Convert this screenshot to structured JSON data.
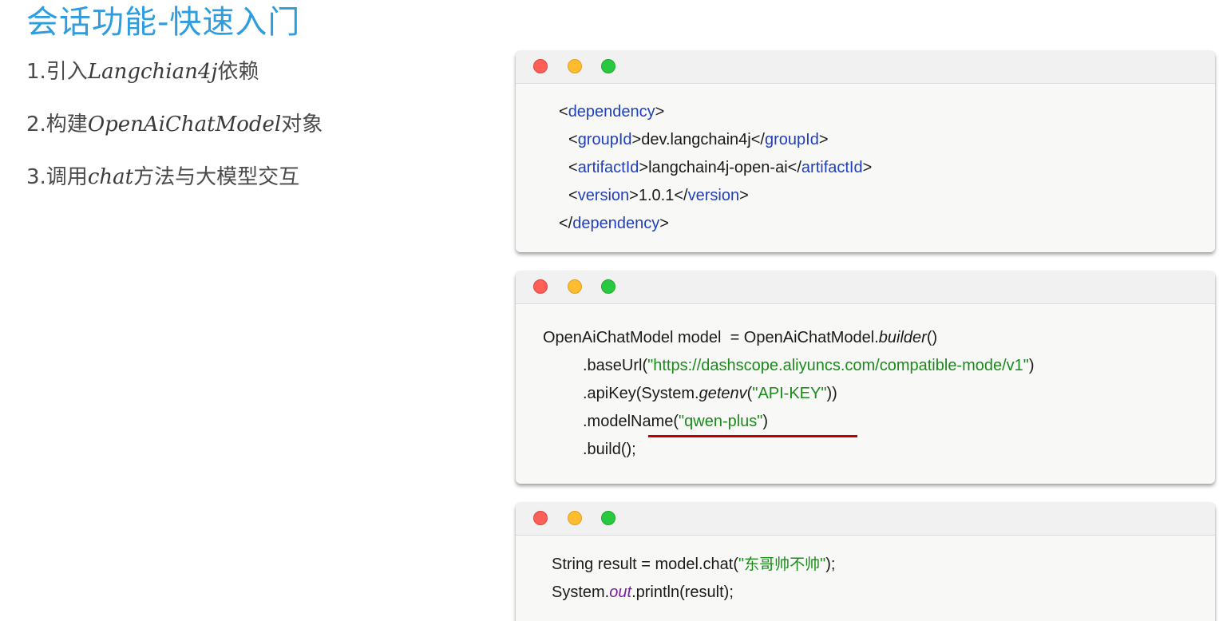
{
  "slide": {
    "title": "会话功能-快速入门",
    "steps": [
      {
        "prefix": "1.引入",
        "keyword": "Langchian4j",
        "suffix": "依赖"
      },
      {
        "prefix": "2.构建",
        "keyword": "OpenAiChatModel",
        "suffix": "对象"
      },
      {
        "prefix": "3.调用",
        "keyword": "chat",
        "suffix": "方法与大模型交互"
      }
    ]
  },
  "code1": {
    "dep_open_lt": "<",
    "dep_tag": "dependency",
    "gt": ">",
    "groupId_tag": "groupId",
    "groupId_value": "dev.langchain4j",
    "artifactId_tag": "artifactId",
    "artifactId_value": "langchain4j-open-ai",
    "version_tag": "version",
    "version_value": "1.0.1",
    "close_lt": "</"
  },
  "code2": {
    "line1_a": "OpenAiChatModel model  = OpenAiChatModel.",
    "line1_method": "builder",
    "line1_b": "()",
    "line2_a": ".baseUrl(",
    "line2_str": "\"https://dashscope.aliyuncs.com/compatible-mode/v1\"",
    "line2_b": ")",
    "line3_a": ".apiKey(System.",
    "line3_method": "getenv",
    "line3_p": "(",
    "line3_str": "\"API-KEY\"",
    "line3_b": "))",
    "line4_a": ".modelName(",
    "line4_str": "\"qwen-plus\"",
    "line4_b": ")",
    "line5": ".build();"
  },
  "code3": {
    "line1_a": "String result = model.chat(",
    "line1_q1": "\"",
    "line1_cn": "东哥帅不帅",
    "line1_q2": "\"",
    "line1_b": ");",
    "line2_a": "System.",
    "line2_field": "out",
    "line2_b": ".println(result);"
  },
  "colors": {
    "title": "#2e9de0",
    "tag": "#1f3fbf",
    "string": "#1a8a1a",
    "field": "#7a1fa2",
    "highlight_underline": "#c00000",
    "dot_red": "#fe5f57",
    "dot_yellow": "#febc2e",
    "dot_green": "#28c840"
  }
}
